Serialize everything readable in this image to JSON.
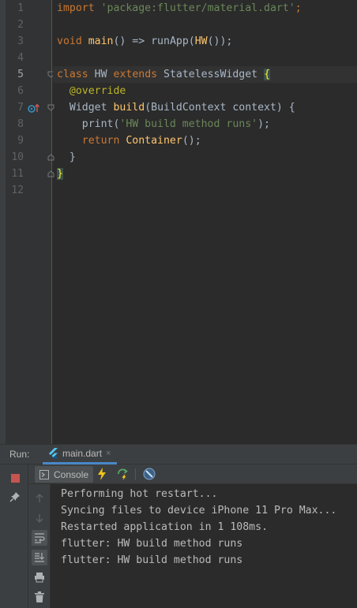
{
  "editor": {
    "current_line": 5,
    "line_numbers": [
      "1",
      "2",
      "3",
      "4",
      "5",
      "6",
      "7",
      "8",
      "9",
      "10",
      "11",
      "12"
    ],
    "code": {
      "l1": {
        "kw": "import",
        "str": "'package:flutter/material.dart'",
        "end": ";"
      },
      "l3": {
        "kw": "void",
        "fn": "main",
        "mid": "() => runApp(",
        "call": "HW",
        "end": "());"
      },
      "l5": {
        "kw1": "class",
        "name": "HW",
        "kw2": "extends",
        "base": "StatelessWidget",
        "brace": "{"
      },
      "l6": {
        "ann": "@override"
      },
      "l7": {
        "type": "Widget",
        "fn": "build",
        "params": "(BuildContext context) {"
      },
      "l8": {
        "pre": "print(",
        "str": "'HW build method runs'",
        "end": ");"
      },
      "l9": {
        "kw": "return",
        "fn": "Container",
        "end": "();"
      },
      "l10": {
        "text": "}"
      },
      "l11": {
        "brace": "}"
      }
    },
    "gutter_icons": {
      "line7": "override-method-icon",
      "fold": "fold-marker-icon"
    }
  },
  "run_panel": {
    "label": "Run:",
    "tab": {
      "label": "main.dart",
      "close": "×",
      "icon": "flutter-icon"
    },
    "left_toolbar": [
      "stop-icon",
      "pin-icon"
    ],
    "console_toolbar": {
      "tab_label": "Console",
      "tab_icon": "console-icon",
      "tools": [
        "hot-reload-icon",
        "hot-restart-icon",
        "flutter-inspector-icon"
      ]
    },
    "side_tools": [
      "scroll-up-icon",
      "scroll-down-icon",
      "soft-wrap-icon",
      "scroll-to-end-icon",
      "print-icon",
      "trash-icon"
    ],
    "output": [
      "Performing hot restart...",
      "Syncing files to device iPhone 11 Pro Max...",
      "Restarted application in 1 108ms.",
      "flutter: HW build method runs",
      "flutter: HW build method runs"
    ],
    "colors": {
      "stop": "#c75450",
      "accent_tab": "#4a88c7",
      "hot_reload": "#f0c419",
      "hot_restart": "#59a869"
    }
  }
}
